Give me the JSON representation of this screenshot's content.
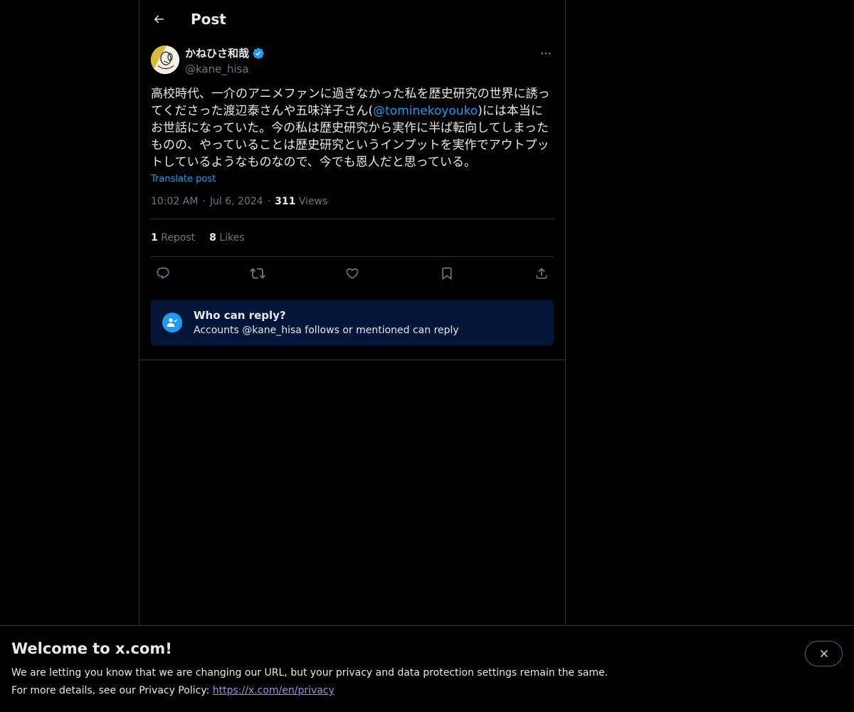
{
  "header": {
    "title": "Post"
  },
  "post": {
    "author": {
      "display_name": "かねひさ和哉",
      "handle": "@kane_hisa",
      "verified": true
    },
    "text_before": "高校時代、一介のアニメファンに過ぎなかった私を歴史研究の世界に誘ってくださった渡辺泰さんや五味洋子さん(",
    "mention": "@tominekoyouko",
    "text_after": ")には本当にお世話になっていた。今の私は歴史研究から実作に半ば転向してしまったものの、やっていることは歴史研究というインプットを実作でアウトプットしているようなものなので、今でも恩人だと思っている。",
    "translate_label": "Translate post",
    "time": "10:02 AM",
    "date": "Jul 6, 2024",
    "views_count": "311",
    "views_label": "Views",
    "reposts_count": "1",
    "reposts_label": "Repost",
    "likes_count": "8",
    "likes_label": "Likes"
  },
  "reply_settings": {
    "title": "Who can reply?",
    "description": "Accounts @kane_hisa follows or mentioned can reply"
  },
  "banner": {
    "title": "Welcome to x.com!",
    "line1": "We are letting you know that we are changing our URL, but your privacy and data protection settings remain the same.",
    "line2_prefix": "For more details, see our Privacy Policy: ",
    "link": "https://x.com/en/privacy"
  },
  "colors": {
    "background": "#000000",
    "accent": "#1d9bf0",
    "muted": "#71767b",
    "reply_box": "#031539",
    "link": "#9f8fe8"
  },
  "icons": {
    "back": "arrow-left-icon",
    "verified": "verified-badge-icon",
    "more": "more-horizontal-icon",
    "reply": "comment-icon",
    "repost": "repost-icon",
    "like": "heart-icon",
    "bookmark": "bookmark-icon",
    "share": "share-icon",
    "reply_settings": "person-check-icon",
    "close": "close-icon"
  }
}
